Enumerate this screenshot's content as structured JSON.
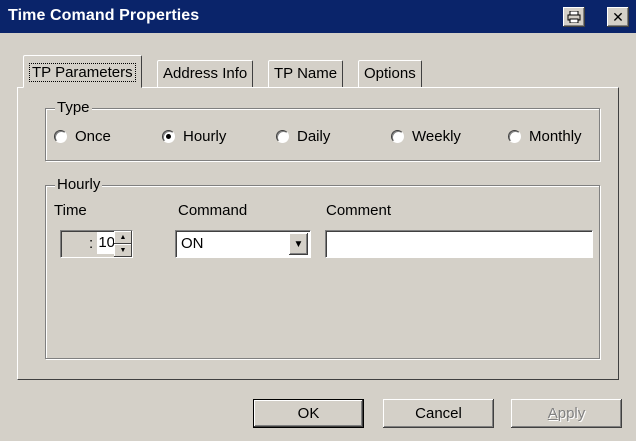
{
  "window": {
    "title": "Time Comand Properties",
    "icons": [
      "printer-icon",
      "close-icon"
    ]
  },
  "tabs": [
    {
      "label": "TP Parameters",
      "active": true
    },
    {
      "label": "Address Info",
      "active": false
    },
    {
      "label": "TP Name",
      "active": false
    },
    {
      "label": "Options",
      "active": false
    }
  ],
  "type_group": {
    "legend": "Type",
    "options": [
      {
        "label": "Once",
        "selected": false
      },
      {
        "label": "Hourly",
        "selected": true
      },
      {
        "label": "Daily",
        "selected": false
      },
      {
        "label": "Weekly",
        "selected": false
      },
      {
        "label": "Monthly",
        "selected": false
      }
    ]
  },
  "hourly_group": {
    "legend": "Hourly",
    "time_label": "Time",
    "command_label": "Command",
    "comment_label": "Comment",
    "time_separator": ":",
    "time_minutes": "10",
    "command_value": "ON",
    "comment_value": ""
  },
  "buttons": {
    "ok": "OK",
    "cancel": "Cancel",
    "apply": "Apply"
  },
  "colors": {
    "title_bar": "#0a246a",
    "face": "#d4d0c8"
  }
}
